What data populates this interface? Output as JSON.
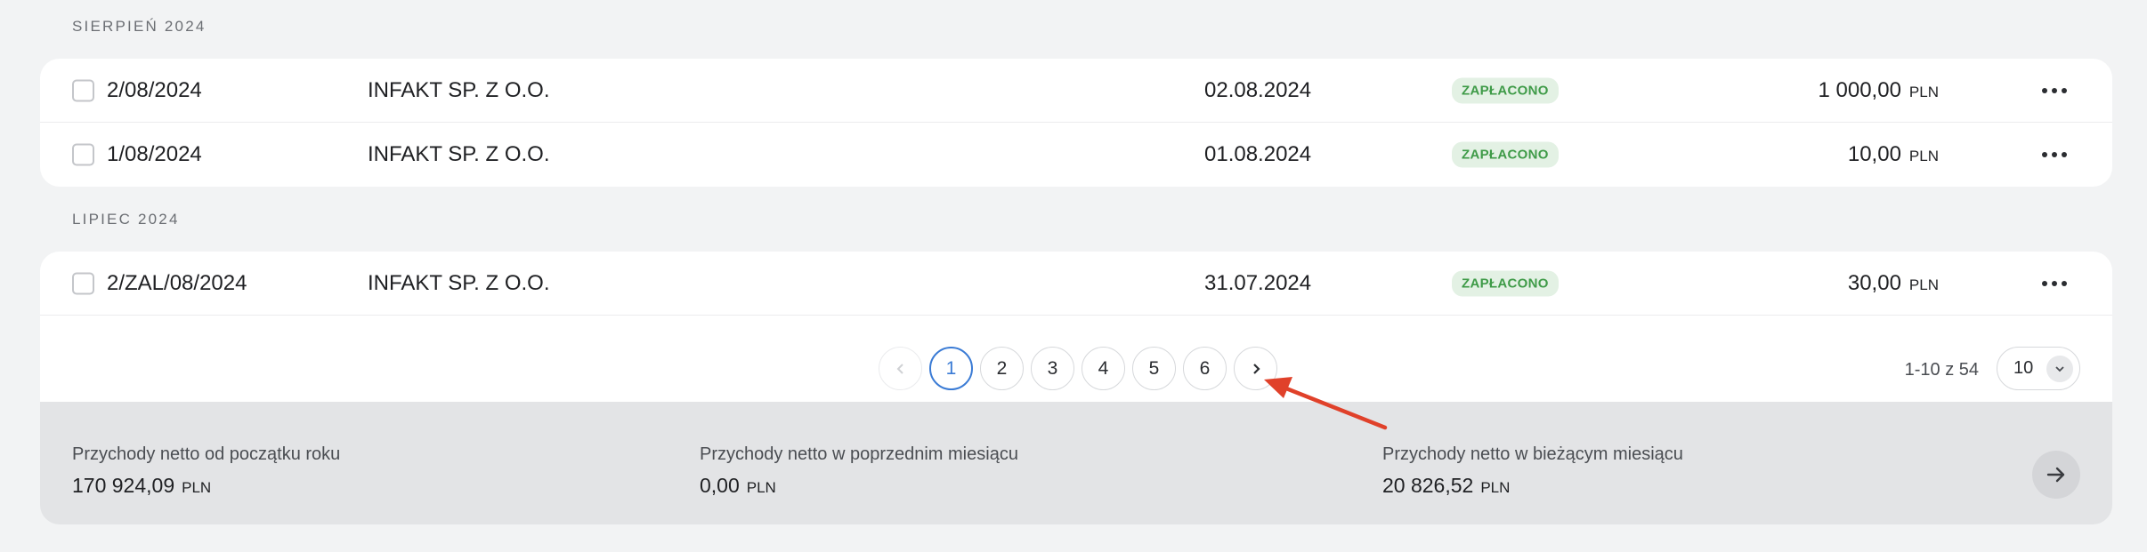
{
  "groups": [
    {
      "label": "SIERPIEŃ 2024",
      "rows": [
        {
          "number": "2/08/2024",
          "client": "INFAKT SP. Z O.O.",
          "date": "02.08.2024",
          "status": "ZAPŁACONO",
          "amount": "1 000,00",
          "currency": "PLN"
        },
        {
          "number": "1/08/2024",
          "client": "INFAKT SP. Z O.O.",
          "date": "01.08.2024",
          "status": "ZAPŁACONO",
          "amount": "10,00",
          "currency": "PLN"
        }
      ]
    },
    {
      "label": "LIPIEC 2024",
      "rows": [
        {
          "number": "2/ZAL/08/2024",
          "client": "INFAKT SP. Z O.O.",
          "date": "31.07.2024",
          "status": "ZAPŁACONO",
          "amount": "30,00",
          "currency": "PLN"
        }
      ]
    }
  ],
  "pagination": {
    "pages": [
      "1",
      "2",
      "3",
      "4",
      "5",
      "6"
    ],
    "current": "1",
    "range_text": "1-10 z 54",
    "per_page": "10"
  },
  "summary": {
    "stats": [
      {
        "label": "Przychody netto od początku roku",
        "value": "170 924,09",
        "currency": "PLN"
      },
      {
        "label": "Przychody netto w poprzednim miesiącu",
        "value": "0,00",
        "currency": "PLN"
      },
      {
        "label": "Przychody netto w bieżącym miesiącu",
        "value": "20 826,52",
        "currency": "PLN"
      }
    ]
  },
  "colors": {
    "accent": "#3a7bd5",
    "paid_badge_bg": "#e3f1e4",
    "paid_badge_text": "#3f9b48",
    "annotation_arrow": "#e0412a"
  },
  "icons": {
    "prev": "chevron-left-icon",
    "next": "chevron-right-icon",
    "per_page_toggle": "chevron-down-icon",
    "row_menu": "more-horizontal-icon",
    "summary_go": "arrow-right-icon"
  }
}
